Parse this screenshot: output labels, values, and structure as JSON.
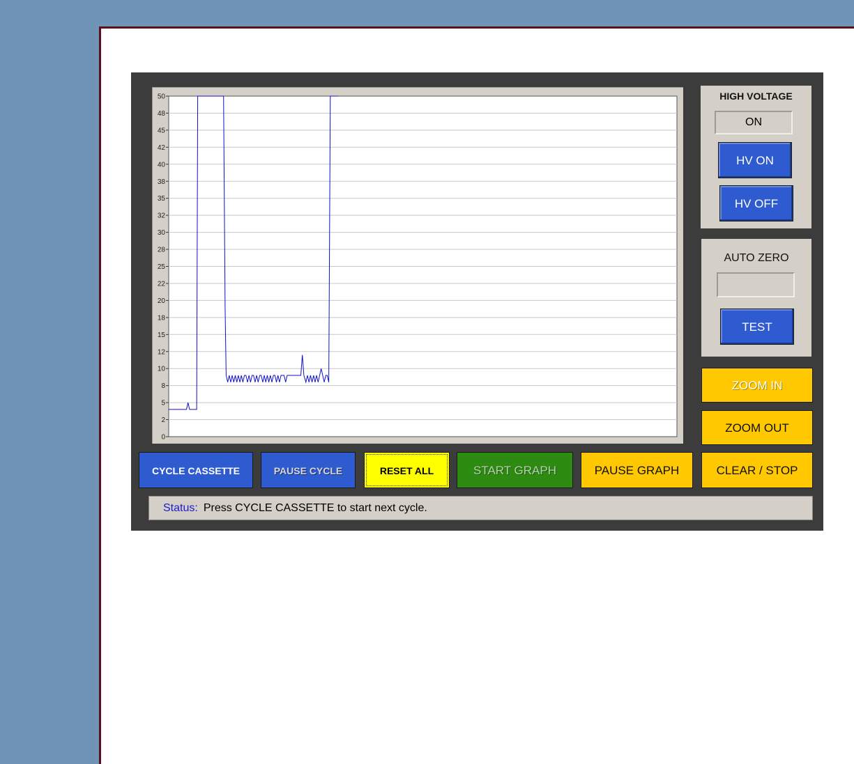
{
  "high_voltage": {
    "title": "HIGH VOLTAGE",
    "state": "ON",
    "on_label": "HV ON",
    "off_label": "HV OFF"
  },
  "auto_zero": {
    "title": "AUTO ZERO",
    "value": "",
    "test_label": "TEST"
  },
  "zoom": {
    "in_label": "ZOOM IN",
    "out_label": "ZOOM OUT"
  },
  "controls": {
    "cycle_cassette": "CYCLE CASSETTE",
    "pause_cycle": "PAUSE CYCLE",
    "reset_all": "RESET ALL",
    "start_graph": "START GRAPH",
    "pause_graph": "PAUSE GRAPH",
    "clear_stop": "CLEAR / STOP"
  },
  "status": {
    "label": "Status:",
    "message": "Press CYCLE CASSETTE to start next cycle."
  },
  "colors": {
    "line": "#1010c8",
    "blue_button": "#2f5bd0",
    "yellow_button": "#ffc800",
    "green_button": "#2e8b12"
  },
  "chart_data": {
    "type": "line",
    "title": "",
    "xlabel": "",
    "ylabel": "",
    "ylim": [
      0,
      50
    ],
    "xlim": [
      0,
      100
    ],
    "yticks": [
      "0",
      "2",
      "5",
      "8",
      "10",
      "12",
      "15",
      "18",
      "20",
      "22",
      "25",
      "28",
      "30",
      "32",
      "35",
      "38",
      "40",
      "42",
      "45",
      "48",
      "50"
    ],
    "grid": true,
    "series": [
      {
        "x": [
          0,
          3.5,
          3.8,
          4.1,
          4.4,
          5.5,
          5.6,
          5.7,
          10.8,
          11.1,
          11.3,
          11.6,
          11.9,
          12.2,
          12.5,
          12.8,
          13.1,
          13.4,
          13.7,
          14,
          14.3,
          14.6,
          14.9,
          15.2,
          15.5,
          15.8,
          16.1,
          16.4,
          16.7,
          17,
          17.3,
          17.6,
          17.9,
          18.2,
          18.5,
          18.8,
          19.1,
          19.4,
          19.7,
          20,
          20.3,
          20.6,
          20.9,
          21.2,
          21.5,
          21.8,
          22.1,
          22.4,
          22.7,
          23,
          23.3,
          23.6,
          23.9,
          24.2,
          24.5,
          24.8,
          25.1,
          25.4,
          25.7,
          26,
          26.3,
          26.6,
          27,
          27.3,
          27.6,
          27.9,
          28.2,
          28.5,
          28.8,
          29.1,
          29.4,
          29.7,
          30,
          30.3,
          30.6,
          30.9,
          31.2,
          31.5,
          31.8,
          32.1,
          32.4,
          32.7,
          33,
          33.3
        ],
        "y": [
          4,
          4,
          5,
          4,
          4,
          4,
          26,
          50,
          50,
          19,
          9,
          8,
          9,
          8,
          9,
          8,
          9,
          8,
          9,
          8,
          9,
          8,
          9,
          9,
          8,
          9,
          8,
          9,
          9,
          8,
          9,
          8,
          9,
          9,
          8,
          9,
          8,
          9,
          8,
          9,
          8,
          9,
          9,
          8,
          9,
          8,
          9,
          9,
          9,
          8,
          9,
          9,
          9,
          9,
          9,
          9,
          9,
          9,
          9,
          9,
          12,
          9,
          8,
          9,
          8,
          9,
          8,
          9,
          8,
          9,
          8,
          9,
          10,
          9,
          8,
          9,
          9,
          8,
          50,
          50,
          50,
          50,
          50,
          50
        ]
      }
    ]
  }
}
